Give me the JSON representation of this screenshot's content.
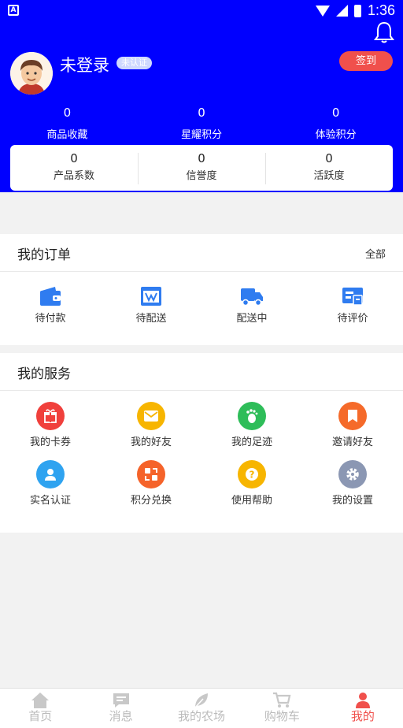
{
  "status_bar": {
    "time": "1:36",
    "app_icon_letter": "A"
  },
  "header": {
    "username": "未登录",
    "login_badge": "未认证",
    "checkin_label": "签到",
    "stats": [
      {
        "value": "0",
        "label": "商品收藏"
      },
      {
        "value": "0",
        "label": "星耀积分"
      },
      {
        "value": "0",
        "label": "体验积分"
      }
    ],
    "card_stats": [
      {
        "value": "0",
        "label": "产品系数"
      },
      {
        "value": "0",
        "label": "信誉度"
      },
      {
        "value": "0",
        "label": "活跃度"
      }
    ]
  },
  "orders": {
    "title": "我的订单",
    "more": "全部",
    "items": [
      {
        "label": "待付款",
        "icon": "wallet-icon"
      },
      {
        "label": "待配送",
        "icon": "package-icon"
      },
      {
        "label": "配送中",
        "icon": "truck-icon"
      },
      {
        "label": "待评价",
        "icon": "review-icon"
      }
    ]
  },
  "services": {
    "title": "我的服务",
    "items": [
      {
        "label": "我的卡券",
        "icon": "gift-icon",
        "color": "#f0403c"
      },
      {
        "label": "我的好友",
        "icon": "envelope-icon",
        "color": "#f7b500"
      },
      {
        "label": "我的足迹",
        "icon": "footprint-icon",
        "color": "#2ebd59"
      },
      {
        "label": "邀请好友",
        "icon": "bookmark-icon",
        "color": "#f56a2a"
      },
      {
        "label": "实名认证",
        "icon": "user-badge-icon",
        "color": "#2fa3f0"
      },
      {
        "label": "积分兑换",
        "icon": "exchange-icon",
        "color": "#f5632a"
      },
      {
        "label": "使用帮助",
        "icon": "question-icon",
        "color": "#f7b500"
      },
      {
        "label": "我的设置",
        "icon": "gear-icon",
        "color": "#8b97b3"
      }
    ]
  },
  "bottom_nav": {
    "items": [
      {
        "label": "首页",
        "icon": "home-icon"
      },
      {
        "label": "消息",
        "icon": "message-icon"
      },
      {
        "label": "我的农场",
        "icon": "leaf-icon"
      },
      {
        "label": "购物车",
        "icon": "cart-icon"
      },
      {
        "label": "我的",
        "icon": "person-icon"
      }
    ],
    "active_index": 4
  },
  "colors": {
    "brand_blue": "#0000ff",
    "accent_red": "#f0504c",
    "order_icon_blue": "#2f7cf0"
  }
}
